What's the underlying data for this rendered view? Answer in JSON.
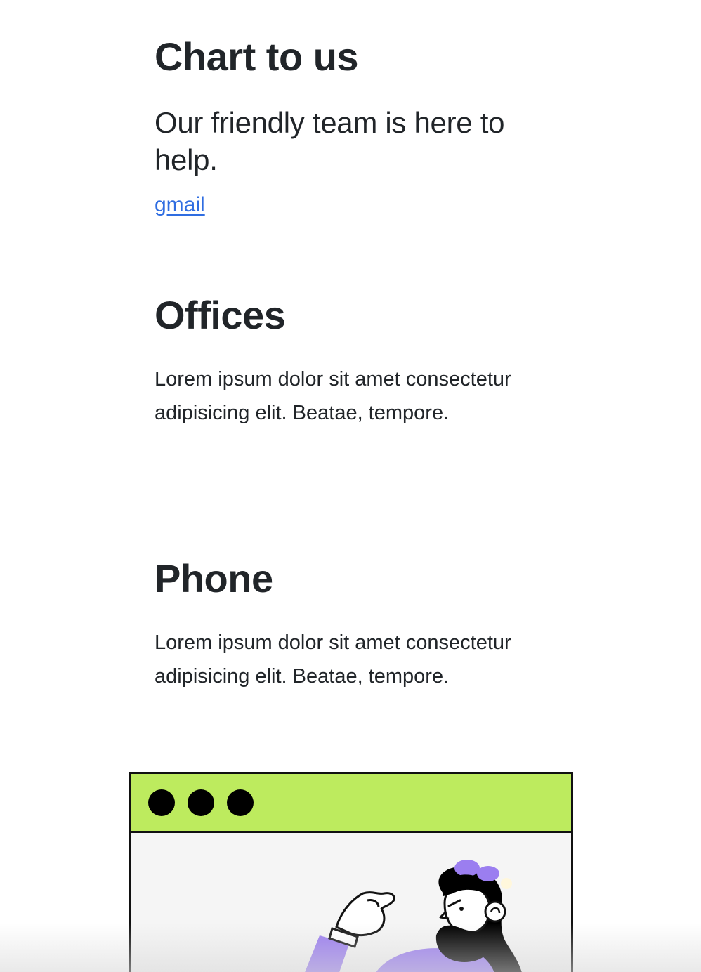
{
  "contact": {
    "title": "Chart to us",
    "subtitle": "Our friendly team is here to help.",
    "link_label": "gmail"
  },
  "offices": {
    "title": "Offices",
    "text": "Lorem ipsum dolor sit amet consectetur adipisicing elit. Beatae, tempore."
  },
  "phone": {
    "title": "Phone",
    "text": "Lorem ipsum dolor sit amet consectetur adipisicing elit. Beatae, tempore."
  },
  "illustration": {
    "icon": "browser-window-person-illustration",
    "bar_color": "#bdeb5e",
    "accent_color": "#9b7ef0"
  },
  "colors": {
    "text": "#212529",
    "link": "#2f6de1"
  }
}
